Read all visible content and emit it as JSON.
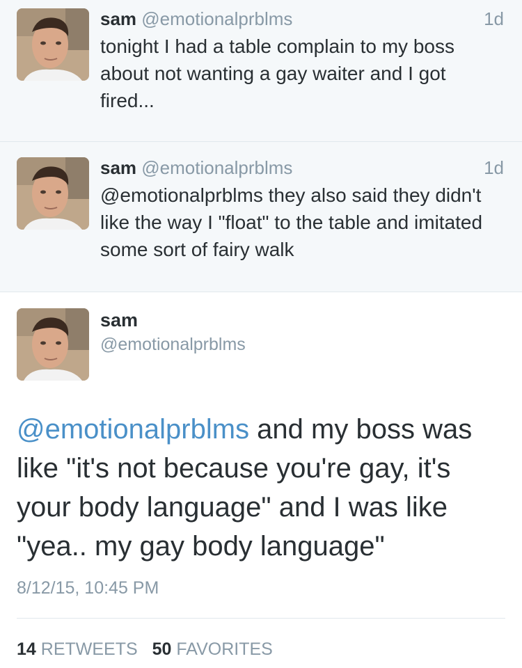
{
  "tweets": [
    {
      "name": "sam",
      "handle": "@emotionalprblms",
      "time": "1d",
      "text": "tonight I had a table complain to my boss about not wanting a gay waiter and I got fired..."
    },
    {
      "name": "sam",
      "handle": "@emotionalprblms",
      "time": "1d",
      "text": "@emotionalprblms they also said they didn't like the way I \"float\" to the table and imitated some sort of fairy walk"
    }
  ],
  "detail": {
    "name": "sam",
    "handle": "@emotionalprblms",
    "mention": "@emotionalprblms",
    "text": " and my boss was like \"it's not because you're gay, it's your body language\" and I was like \"yea.. my gay body language\"",
    "timestamp": "8/12/15, 10:45 PM",
    "retweets_count": "14",
    "retweets_label": "RETWEETS",
    "favorites_count": "50",
    "favorites_label": "FAVORITES"
  },
  "colors": {
    "compact_bg": "#f5f8fa",
    "name": "#292f33",
    "muted": "#8899a6",
    "mention": "#4a90c8"
  }
}
